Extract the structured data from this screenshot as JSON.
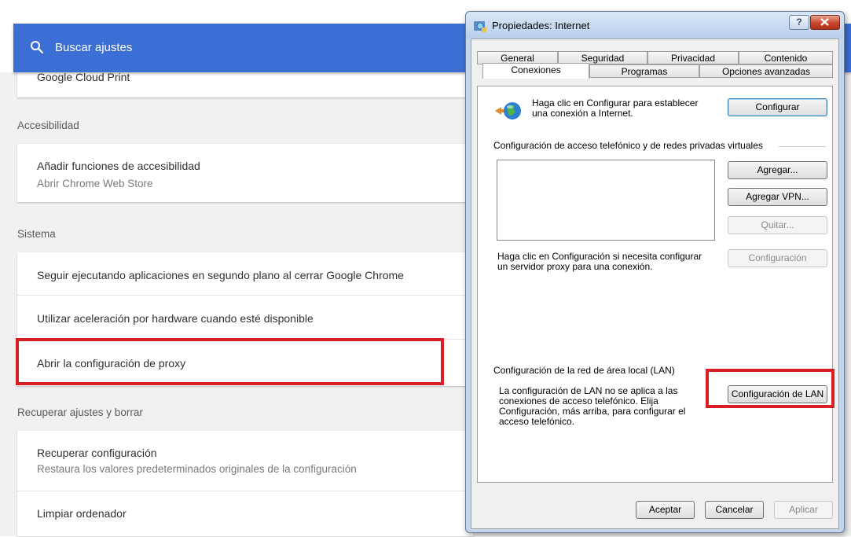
{
  "search": {
    "placeholder": "Buscar ajustes"
  },
  "cards": {
    "cloud_print": "Google Cloud Print",
    "accessibility": {
      "section_title": "Accesibilidad",
      "title": "Añadir funciones de accesibilidad",
      "subtitle": "Abrir Chrome Web Store"
    },
    "system": {
      "section_title": "Sistema",
      "items": [
        "Seguir ejecutando aplicaciones en segundo plano al cerrar Google Chrome",
        "Utilizar aceleración por hardware cuando esté disponible",
        "Abrir la configuración de proxy"
      ]
    },
    "reset": {
      "section_title": "Recuperar ajustes y borrar",
      "restore_title": "Recuperar configuración",
      "restore_subtitle": "Restaura los valores predeterminados originales de la configuración",
      "cleanup_title": "Limpiar ordenador"
    }
  },
  "dialog": {
    "title": "Propiedades: Internet",
    "help": "?",
    "tabs_row1": [
      "General",
      "Seguridad",
      "Privacidad",
      "Contenido"
    ],
    "tabs_row2": [
      "Conexiones",
      "Programas",
      "Opciones avanzadas"
    ],
    "setup_text": "Haga clic en Configurar para establecer una conexión a Internet.",
    "setup_button": "Configurar",
    "dialup_label": "Configuración de acceso telefónico y de redes privadas virtuales",
    "add_button": "Agregar...",
    "add_vpn_button": "Agregar VPN...",
    "remove_button": "Quitar...",
    "settings_text": "Haga clic en Configuración si necesita configurar un servidor proxy para una conexión.",
    "settings_button": "Configuración",
    "lan_label": "Configuración de la red de área local (LAN)",
    "lan_text": "La configuración de LAN no se aplica a las conexiones de acceso telefónico. Elija Configuración, más arriba, para configurar el acceso telefónico.",
    "lan_button": "Configuración de LAN",
    "ok_button": "Aceptar",
    "cancel_button": "Cancelar",
    "apply_button": "Aplicar"
  }
}
